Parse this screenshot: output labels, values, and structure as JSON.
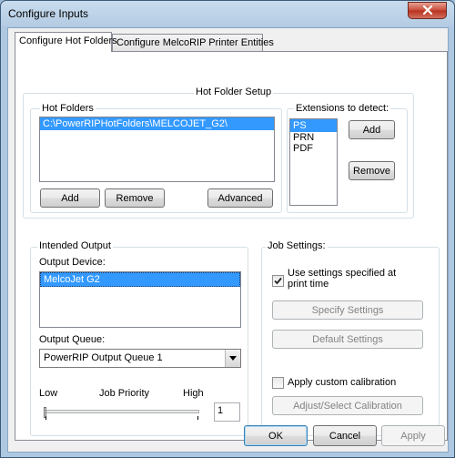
{
  "window": {
    "title": "Configure Inputs"
  },
  "tabs": [
    {
      "label": "Configure Hot Folders"
    },
    {
      "label": "Configure MelcoRIP Printer Entities"
    }
  ],
  "hot_folder_setup": {
    "title": "Hot Folder Setup",
    "hot_folders": {
      "label": "Hot Folders",
      "items": [
        "C:\\PowerRIPHotFolders\\MELCOJET_G2\\"
      ],
      "add_label": "Add",
      "remove_label": "Remove",
      "advanced_label": "Advanced"
    },
    "extensions": {
      "label": "Extensions to detect:",
      "items": [
        "PS",
        "PRN",
        "PDF"
      ],
      "selected": "PS",
      "add_label": "Add",
      "remove_label": "Remove"
    }
  },
  "intended_output": {
    "label": "Intended Output",
    "device_label": "Output Device:",
    "devices": [
      "MelcoJet G2"
    ],
    "queue_label": "Output Queue:",
    "queue_value": "PowerRIP Output Queue 1",
    "priority": {
      "low": "Low",
      "title": "Job Priority",
      "high": "High",
      "value": "1"
    }
  },
  "job_settings": {
    "label": "Job Settings:",
    "use_settings_label": "Use settings specified at print time",
    "use_settings_checked": true,
    "specify_label": "Specify Settings",
    "default_label": "Default Settings",
    "custom_calibration_label": "Apply custom calibration",
    "custom_calibration_checked": false,
    "adjust_calibration_label": "Adjust/Select Calibration"
  },
  "footer": {
    "ok_label": "OK",
    "cancel_label": "Cancel",
    "apply_label": "Apply"
  },
  "colors": {
    "selection": "#3399ff",
    "close_button": "#c74a37"
  },
  "icons": {
    "close": "close-icon",
    "dropdown": "chevron-down-icon",
    "checkmark": "checkmark-icon"
  }
}
